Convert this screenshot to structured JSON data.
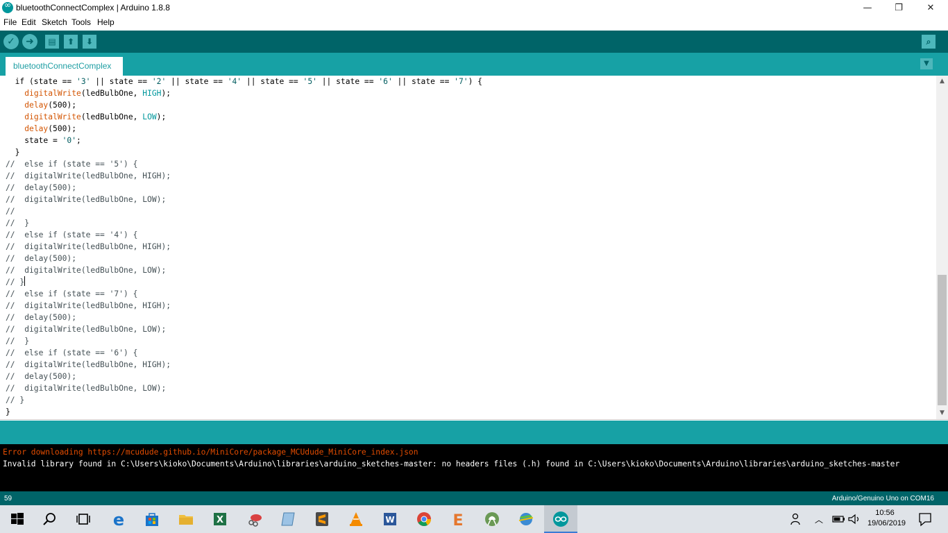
{
  "window": {
    "title": "bluetoothConnectComplex | Arduino 1.8.8",
    "controls": {
      "minimize": "—",
      "maximize": "❐",
      "close": "✕"
    }
  },
  "menu": [
    "File",
    "Edit",
    "Sketch",
    "Tools",
    "Help"
  ],
  "toolbar": {
    "buttons": [
      "verify-icon",
      "upload-icon",
      "new-icon",
      "open-icon",
      "save-icon"
    ],
    "serial_monitor": "serial-monitor-icon"
  },
  "tabs": [
    {
      "label": "bluetoothConnectComplex",
      "active": true
    }
  ],
  "editor": {
    "lines": [
      "  if (state == '3' || state == '2' || state == '4' || state == '5' || state == '6' || state == '7') {",
      "    digitalWrite(ledBulbOne, HIGH);",
      "    delay(500);",
      "    digitalWrite(ledBulbOne, LOW);",
      "    delay(500);",
      "    state = '0';",
      "  }",
      "//  else if (state == '5') {",
      "//  digitalWrite(ledBulbOne, HIGH);",
      "//  delay(500);",
      "//  digitalWrite(ledBulbOne, LOW);",
      "//",
      "//  }",
      "//  else if (state == '4') {",
      "//  digitalWrite(ledBulbOne, HIGH);",
      "//  delay(500);",
      "//  digitalWrite(ledBulbOne, LOW);",
      "// }",
      "//  else if (state == '7') {",
      "//  digitalWrite(ledBulbOne, HIGH);",
      "//  delay(500);",
      "//  digitalWrite(ledBulbOne, LOW);",
      "//  }",
      "//  else if (state == '6') {",
      "//  digitalWrite(ledBulbOne, HIGH);",
      "//  delay(500);",
      "//  digitalWrite(ledBulbOne, LOW);",
      "// }",
      "}"
    ],
    "caret_line": 18,
    "scroll_fraction": 0.6
  },
  "console": {
    "error": "Error downloading https://mcudude.github.io/MiniCore/package_MCUdude_MiniCore_index.json",
    "message": "Invalid library found in C:\\Users\\kioko\\Documents\\Arduino\\libraries\\arduino_sketches-master: no headers files (.h) found in C:\\Users\\kioko\\Documents\\Arduino\\libraries\\arduino_sketches-master"
  },
  "status": {
    "line_number": "59",
    "board": "Arduino/Genuino Uno on COM16"
  },
  "taskbar": {
    "apps": [
      "start-icon",
      "search-icon",
      "task-view-icon",
      "edge-icon",
      "store-icon",
      "file-explorer-icon",
      "excel-icon",
      "snipping-tool-icon",
      "notes-icon",
      "sublime-text-icon",
      "vlc-icon",
      "word-icon",
      "chrome-icon",
      "e-app-icon",
      "android-studio-icon",
      "globe-app-icon",
      "arduino-icon"
    ],
    "clock_time": "10:56",
    "clock_date": "19/06/2019"
  },
  "colors": {
    "toolbar": "#006468",
    "tab_row": "#17a1a5",
    "keyword": "#d35400",
    "constant": "#00979c",
    "error_text": "#e34c00"
  }
}
